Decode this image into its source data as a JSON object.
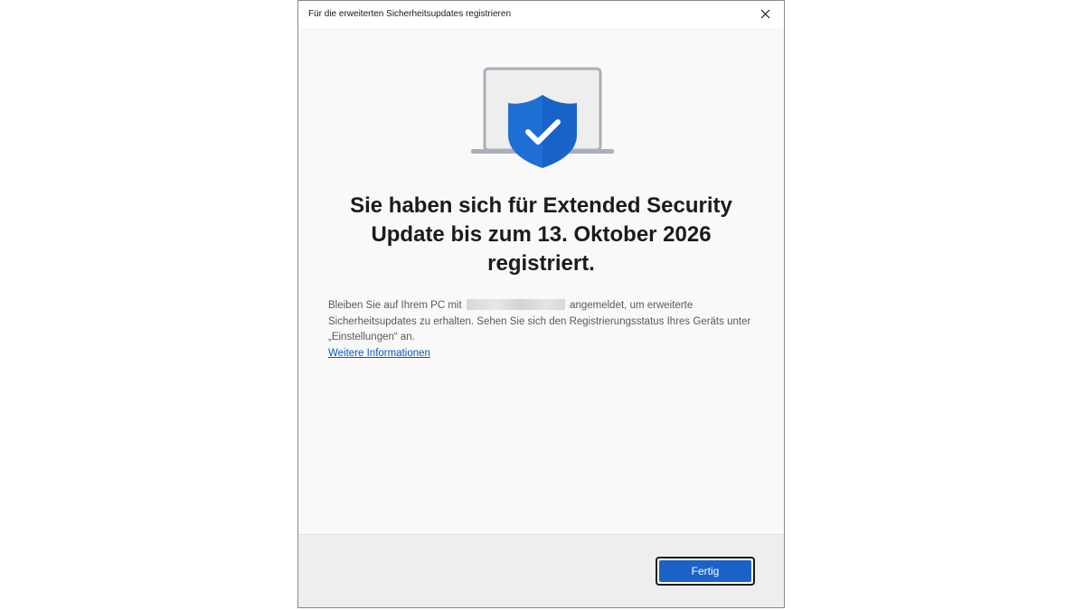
{
  "window": {
    "title": "Für die erweiterten Sicherheitsupdates registrieren",
    "close_icon": "close-icon"
  },
  "hero": {
    "icon": "laptop-shield-check-icon",
    "accent_color": "#1d6fd6"
  },
  "headline": "Sie haben sich für Extended Security Update bis zum 13. Oktober 2026 registriert.",
  "body": {
    "text_before": "Bleiben Sie auf Ihrem PC mit",
    "text_after": "angemeldet, um erweiterte Sicherheitsupdates zu erhalten. Sehen Sie sich den Registrierungsstatus Ihres Geräts unter „Einstellungen“ an.",
    "link": "Weitere Informationen"
  },
  "footer": {
    "done_label": "Fertig",
    "accent_color": "#1a62c7"
  }
}
